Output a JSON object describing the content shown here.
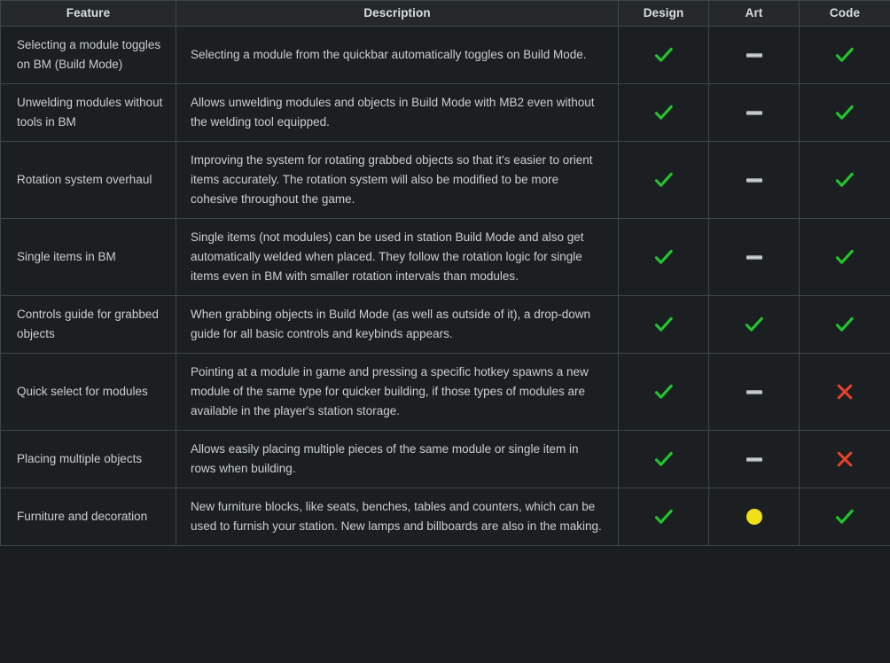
{
  "table": {
    "columns": [
      {
        "key": "feature",
        "label": "Feature"
      },
      {
        "key": "description",
        "label": "Description"
      },
      {
        "key": "design",
        "label": "Design"
      },
      {
        "key": "art",
        "label": "Art"
      },
      {
        "key": "code",
        "label": "Code"
      }
    ],
    "status_icons": {
      "check": "check-icon",
      "dash": "dash-icon",
      "cross": "cross-icon",
      "circle": "circle-icon"
    },
    "colors": {
      "check": "#22c52e",
      "cross": "#e8412c",
      "circle": "#f2e017",
      "dash": "#cfd4d6",
      "header_bg": "#25292b",
      "row_bg": "#1c1f21",
      "border": "#3e4649",
      "text": "#c9ced1"
    },
    "rows": [
      {
        "feature": "Selecting a module toggles on BM (Build Mode)",
        "description": "Selecting a module from the quickbar automatically toggles on Build Mode.",
        "design": "check",
        "art": "dash",
        "code": "check"
      },
      {
        "feature": "Unwelding modules without tools in BM",
        "description": "Allows unwelding modules and objects in Build Mode with MB2 even without the welding tool equipped.",
        "design": "check",
        "art": "dash",
        "code": "check"
      },
      {
        "feature": "Rotation system overhaul",
        "description": "Improving the system for rotating grabbed objects so that it's easier to orient items accurately. The rotation system will also be modified to be more cohesive throughout the game.",
        "design": "check",
        "art": "dash",
        "code": "check"
      },
      {
        "feature": "Single items in BM",
        "description": "Single items (not modules) can be used in station Build Mode and also get automatically welded when placed. They follow the rotation logic for single items even in BM with smaller rotation intervals than modules.",
        "design": "check",
        "art": "dash",
        "code": "check"
      },
      {
        "feature": "Controls guide for grabbed objects",
        "description": "When grabbing objects in Build Mode (as well as outside of it), a drop-down guide for all basic controls and keybinds appears.",
        "design": "check",
        "art": "check",
        "code": "check"
      },
      {
        "feature": "Quick select for modules",
        "description": "Pointing at a module in game and pressing a specific hotkey spawns a new module of the same type for quicker building, if those types of modules are available in the player's station storage.",
        "design": "check",
        "art": "dash",
        "code": "cross"
      },
      {
        "feature": "Placing multiple objects",
        "description": "Allows easily placing multiple pieces of the same module or single item in rows when building.",
        "design": "check",
        "art": "dash",
        "code": "cross"
      },
      {
        "feature": "Furniture and decoration",
        "description": "New furniture blocks, like seats, benches, tables and counters, which can be used to furnish your station. New lamps and billboards are also in the making.",
        "design": "check",
        "art": "circle",
        "code": "check"
      }
    ]
  }
}
